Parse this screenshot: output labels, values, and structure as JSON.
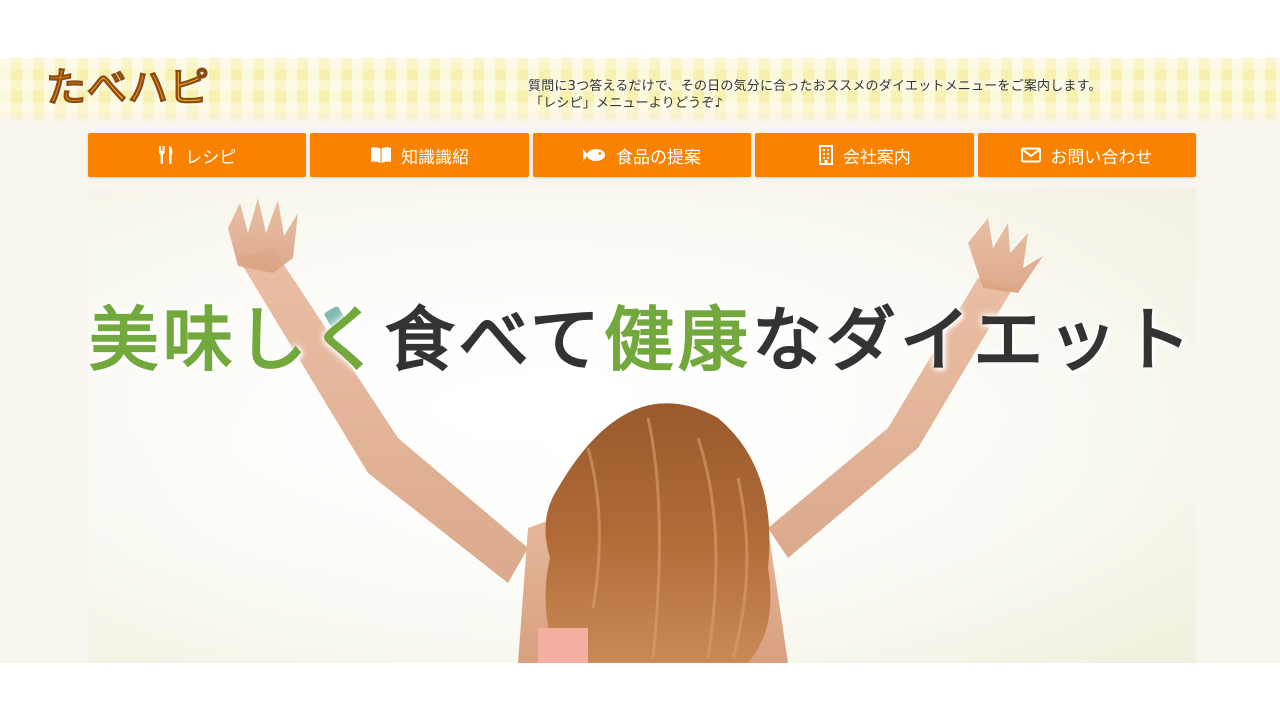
{
  "header": {
    "logo_chars": [
      "た",
      "べ",
      "ハ",
      "ピ"
    ],
    "tagline_line1": "質問に3つ答えるだけで、その日の気分に合ったおススメのダイエットメニューをご案内します。",
    "tagline_line2": "「レシピ」メニューよりどうぞ♪"
  },
  "nav": {
    "items": [
      {
        "label": "レシピ",
        "icon": "fork-knife-icon"
      },
      {
        "label": "知識識紹",
        "icon": "book-icon"
      },
      {
        "label": "食品の提案",
        "icon": "fish-icon"
      },
      {
        "label": "会社案内",
        "icon": "building-icon"
      },
      {
        "label": "お問い合わせ",
        "icon": "envelope-icon"
      }
    ]
  },
  "hero": {
    "headline_parts": [
      "美味しく",
      "食べて",
      "健康",
      "なダイエット"
    ]
  },
  "colors": {
    "nav_orange": "#f98300",
    "headline_green": "#72a83c",
    "headline_dark": "#333333",
    "page_bg": "#f8f4ee"
  }
}
